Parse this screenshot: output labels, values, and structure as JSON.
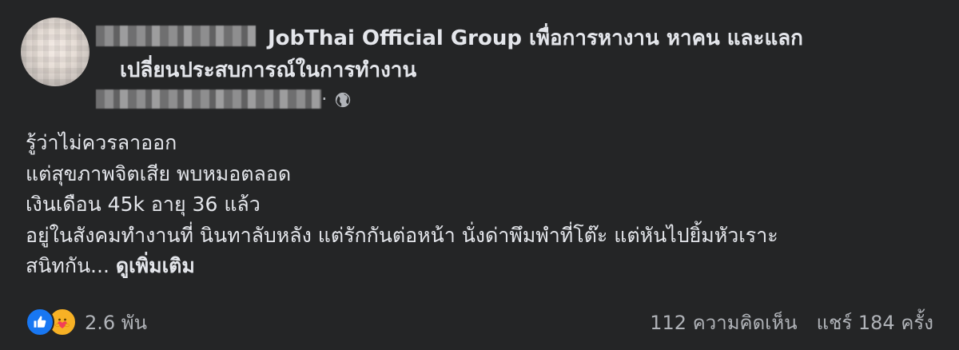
{
  "post": {
    "group_name": "JobThai Official Group เพื่อการหางาน หาคน และแลก",
    "group_name_line2": "เปลี่ยนประสบการณ์ในการทำงาน",
    "meta_separator": "·",
    "privacy_icon": "globe-icon",
    "body_lines": [
      "รู้ว่าไม่ควรลาออก",
      "แต่สุขภาพจิตเสีย พบหมอตลอด",
      "เงินเดือน 45k อายุ 36 แล้ว",
      "อยู่ในสังคมทำงานที่ นินทาลับหลัง แต่รักกันต่อหน้า นั่งด่าพึมพำที่โต๊ะ แต่หันไปยิ้มหัวเราะ",
      "สนิทกัน..."
    ],
    "see_more_label": "ดูเพิ่มเติม"
  },
  "footer": {
    "reactions": [
      "like-icon",
      "care-icon"
    ],
    "reaction_count": "2.6 พัน",
    "comments": "112 ความคิดเห็น",
    "shares": "แชร์ 184 ครั้ง"
  },
  "colors": {
    "background": "#242526",
    "text_primary": "#e4e6eb",
    "text_secondary": "#b0b3b8",
    "like_blue": "#1877f2",
    "care_yellow": "#f7b125"
  }
}
